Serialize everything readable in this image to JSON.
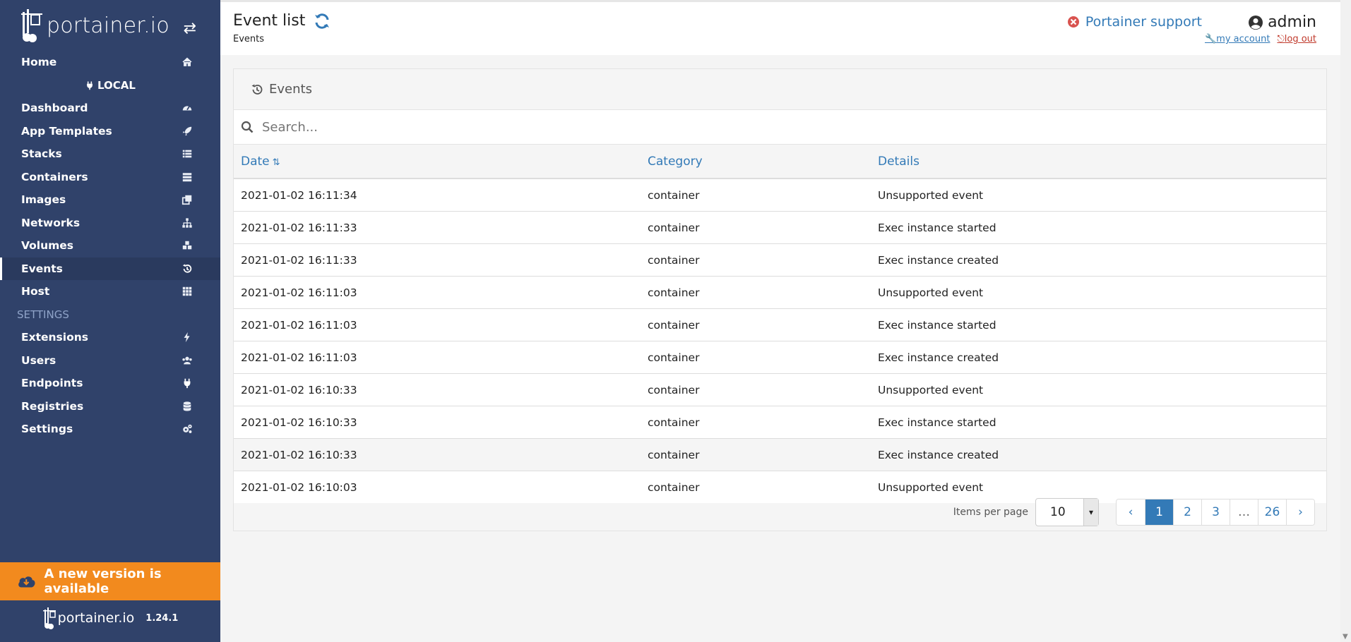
{
  "sidebar": {
    "brand": "portainer.io",
    "items": [
      {
        "label": "Home",
        "icon": "home-icon",
        "kind": "item"
      },
      {
        "label": "LOCAL",
        "icon": "plug-icon",
        "kind": "endpoint"
      },
      {
        "label": "Dashboard",
        "icon": "tachometer-icon",
        "kind": "item"
      },
      {
        "label": "App Templates",
        "icon": "rocket-icon",
        "kind": "item"
      },
      {
        "label": "Stacks",
        "icon": "list-icon",
        "kind": "item"
      },
      {
        "label": "Containers",
        "icon": "server-icon",
        "kind": "item"
      },
      {
        "label": "Images",
        "icon": "clone-icon",
        "kind": "item"
      },
      {
        "label": "Networks",
        "icon": "sitemap-icon",
        "kind": "item"
      },
      {
        "label": "Volumes",
        "icon": "cubes-icon",
        "kind": "item"
      },
      {
        "label": "Events",
        "icon": "history-icon",
        "kind": "item",
        "active": true
      },
      {
        "label": "Host",
        "icon": "th-icon",
        "kind": "item"
      },
      {
        "label": "SETTINGS",
        "icon": "",
        "kind": "section"
      },
      {
        "label": "Extensions",
        "icon": "bolt-icon",
        "kind": "item"
      },
      {
        "label": "Users",
        "icon": "users-icon",
        "kind": "item"
      },
      {
        "label": "Endpoints",
        "icon": "plug-icon",
        "kind": "item"
      },
      {
        "label": "Registries",
        "icon": "database-icon",
        "kind": "item"
      },
      {
        "label": "Settings",
        "icon": "cogs-icon",
        "kind": "item"
      }
    ],
    "update_banner": "A new version is available",
    "footer_brand": "portainer.io",
    "version": "1.24.1"
  },
  "header": {
    "title": "Event list",
    "breadcrumb": "Events",
    "support": "Portainer support",
    "user": "admin",
    "my_account": "my account",
    "log_out": "log out"
  },
  "widget": {
    "title": "Events",
    "search_placeholder": "Search...",
    "columns": [
      "Date",
      "Category",
      "Details"
    ],
    "rows": [
      [
        "2021-01-02 16:11:34",
        "container",
        "Unsupported event"
      ],
      [
        "2021-01-02 16:11:33",
        "container",
        "Exec instance started"
      ],
      [
        "2021-01-02 16:11:33",
        "container",
        "Exec instance created"
      ],
      [
        "2021-01-02 16:11:03",
        "container",
        "Unsupported event"
      ],
      [
        "2021-01-02 16:11:03",
        "container",
        "Exec instance started"
      ],
      [
        "2021-01-02 16:11:03",
        "container",
        "Exec instance created"
      ],
      [
        "2021-01-02 16:10:33",
        "container",
        "Unsupported event"
      ],
      [
        "2021-01-02 16:10:33",
        "container",
        "Exec instance started"
      ],
      [
        "2021-01-02 16:10:33",
        "container",
        "Exec instance created"
      ],
      [
        "2021-01-02 16:10:03",
        "container",
        "Unsupported event"
      ]
    ],
    "items_per_page_label": "Items per page",
    "items_per_page": "10",
    "pages": [
      "‹",
      "1",
      "2",
      "3",
      "…",
      "26",
      "›"
    ],
    "current_page": "1"
  },
  "colors": {
    "sidebar_bg": "#30426a",
    "accent": "#337ab7",
    "update_banner": "#f28a1e"
  }
}
